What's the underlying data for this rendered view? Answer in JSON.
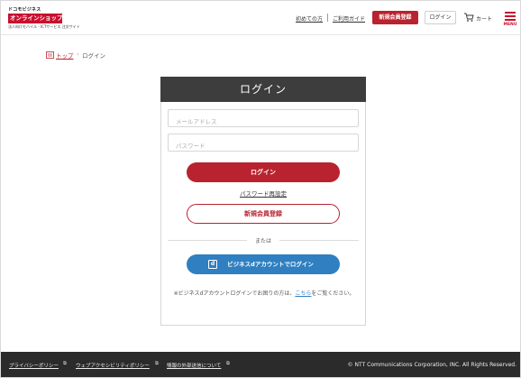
{
  "header": {
    "logo": {
      "brand": "ドコモビジネス",
      "title": "オンラインショップ",
      "subtitle": "法人向けモバイル・ICTサービス 注文サイト"
    },
    "links": {
      "first_time": "初めての方",
      "guide": "ご利用ガイド"
    },
    "register_button": "新規会員登録",
    "login_button": "ログイン",
    "cart_label": "カート",
    "menu_label": "MENU"
  },
  "breadcrumb": {
    "top": "トップ",
    "current": "ログイン"
  },
  "login": {
    "title": "ログイン",
    "email_placeholder": "メールアドレス",
    "password_placeholder": "パスワード",
    "login_button": "ログイン",
    "password_reset": "パスワード再設定",
    "register_button": "新規会員登録",
    "divider": "または",
    "dlogin_button": "ビジネスdアカウントでログイン",
    "note_prefix": "※ビジネスdアカウントログインでお困りの方は、",
    "note_link": "こちら",
    "note_suffix": "をご覧ください。"
  },
  "footer": {
    "links": [
      "プライバシーポリシー",
      "ウェブアクセシビリティポリシー",
      "情報の外部送信について"
    ],
    "copyright": "© NTT Communications Corporation, INC. All Rights Reserved."
  },
  "colors": {
    "brand_red": "#b8232f",
    "panel_header": "#3d3d3d",
    "dlogin_blue": "#2f7fc1",
    "footer_bg": "#2b2b2b"
  }
}
